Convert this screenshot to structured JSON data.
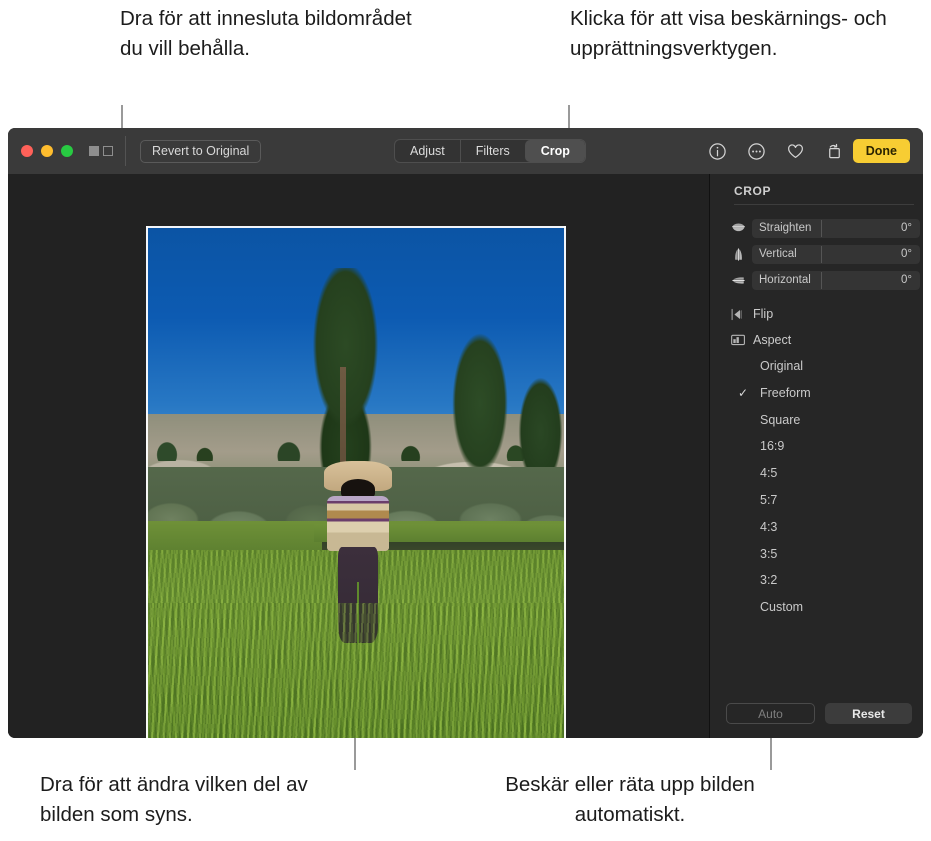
{
  "callouts": {
    "top_left": "Dra för att innesluta bildområdet du vill behålla.",
    "top_right": "Klicka för att visa beskärnings- och upprättningsverktygen.",
    "bottom_left": "Dra för att ändra vilken del av bilden som syns.",
    "bottom_right": "Beskär eller räta upp bilden automatiskt."
  },
  "toolbar": {
    "revert_label": "Revert to Original",
    "segments": [
      {
        "label": "Adjust",
        "selected": false
      },
      {
        "label": "Filters",
        "selected": false
      },
      {
        "label": "Crop",
        "selected": true
      }
    ],
    "icons": [
      "info-icon",
      "more-icon",
      "favorite-icon",
      "rotate-icon",
      "enhance-icon"
    ],
    "done_label": "Done",
    "done_color": "#f7cd33"
  },
  "sidebar": {
    "title": "CROP",
    "sliders": [
      {
        "icon": "straighten-icon",
        "label": "Straighten",
        "value": "0°"
      },
      {
        "icon": "vertical-icon",
        "label": "Vertical",
        "value": "0°"
      },
      {
        "icon": "horizontal-icon",
        "label": "Horizontal",
        "value": "0°"
      }
    ],
    "menu": [
      {
        "icon": "flip-icon",
        "label": "Flip"
      },
      {
        "icon": "aspect-icon",
        "label": "Aspect"
      }
    ],
    "aspects": [
      {
        "label": "Original",
        "checked": false
      },
      {
        "label": "Freeform",
        "checked": true
      },
      {
        "label": "Square",
        "checked": false
      },
      {
        "label": "16:9",
        "checked": false
      },
      {
        "label": "4:5",
        "checked": false
      },
      {
        "label": "5:7",
        "checked": false
      },
      {
        "label": "4:3",
        "checked": false
      },
      {
        "label": "3:5",
        "checked": false
      },
      {
        "label": "3:2",
        "checked": false
      },
      {
        "label": "Custom",
        "checked": false
      }
    ],
    "check_glyph": "✓",
    "buttons": {
      "auto_label": "Auto",
      "reset_label": "Reset"
    }
  },
  "photo": {
    "description": "Child in striped sweater standing in tall green grass meadow with pine trees and rocky ridge under blue sky"
  }
}
